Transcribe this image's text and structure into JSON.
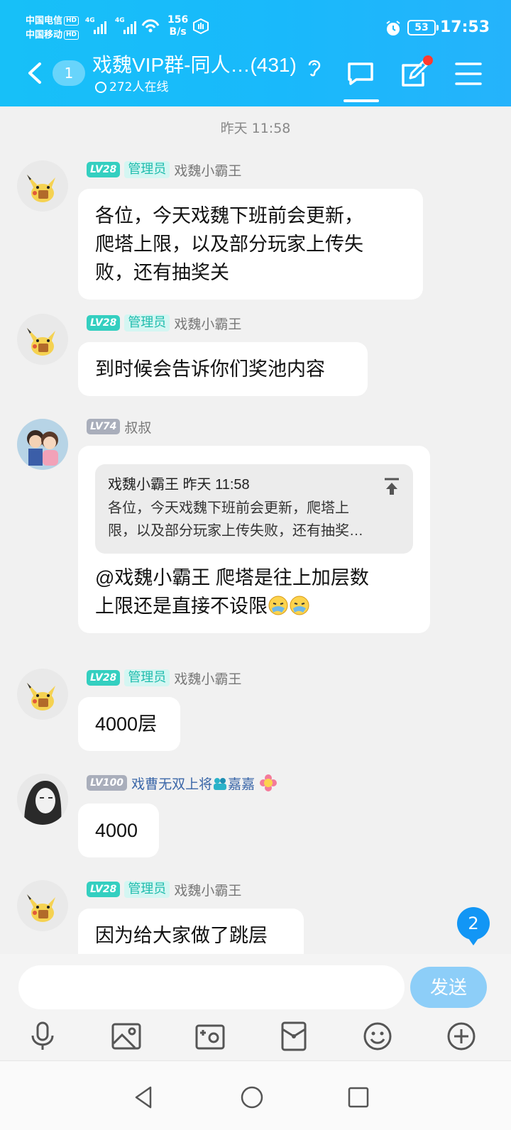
{
  "status_bar": {
    "carrier1": "中国电信",
    "carrier2": "中国移动",
    "hd": "HD",
    "sig_gen": "4G",
    "netspeed_value": "156",
    "netspeed_unit": "B/s",
    "battery": "53",
    "time": "17:53"
  },
  "header": {
    "unread_count": "1",
    "title": "戏魏VIP群-同人…(431)",
    "online": "272人在线"
  },
  "time_separator": "昨天 11:58",
  "messages": [
    {
      "level": "LV28",
      "role": "管理员",
      "name": "戏魏小霸王",
      "text": [
        "各位，今天戏魏下班前会更新，",
        "爬塔上限，以及部分玩家上传失",
        "败，还有抽奖关"
      ]
    },
    {
      "level": "LV28",
      "role": "管理员",
      "name": "戏魏小霸王",
      "text": "到时候会告诉你们奖池内容"
    },
    {
      "level": "LV74",
      "name": "叔叔",
      "quote": {
        "header": "戏魏小霸王  昨天 11:58",
        "line1": "各位，今天戏魏下班前会更新，爬塔上",
        "line2": "限，以及部分玩家上传失败，还有抽奖…"
      },
      "text": [
        "@戏魏小霸王 爬塔是往上加层数",
        "上限还是直接不设限"
      ]
    },
    {
      "level": "LV28",
      "role": "管理员",
      "name": "戏魏小霸王",
      "text": "4000层"
    },
    {
      "level": "LV100",
      "name": "戏曹无双上将",
      "name_suffix": "嘉嘉",
      "text": "4000"
    },
    {
      "level": "LV28",
      "role": "管理员",
      "name": "戏魏小霸王",
      "text": "因为给大家做了跳层"
    }
  ],
  "new_message_badge": "2",
  "input": {
    "placeholder": "",
    "send_label": "发送"
  },
  "toolbar_icons": [
    "microphone-icon",
    "image-icon",
    "camera-icon",
    "red-packet-icon",
    "emoji-icon",
    "plus-icon"
  ],
  "colors": {
    "header": "#19b9fb",
    "admin_badge": "#34cfc0",
    "send_button": "#8dcef8",
    "badge": "#1296f5"
  }
}
